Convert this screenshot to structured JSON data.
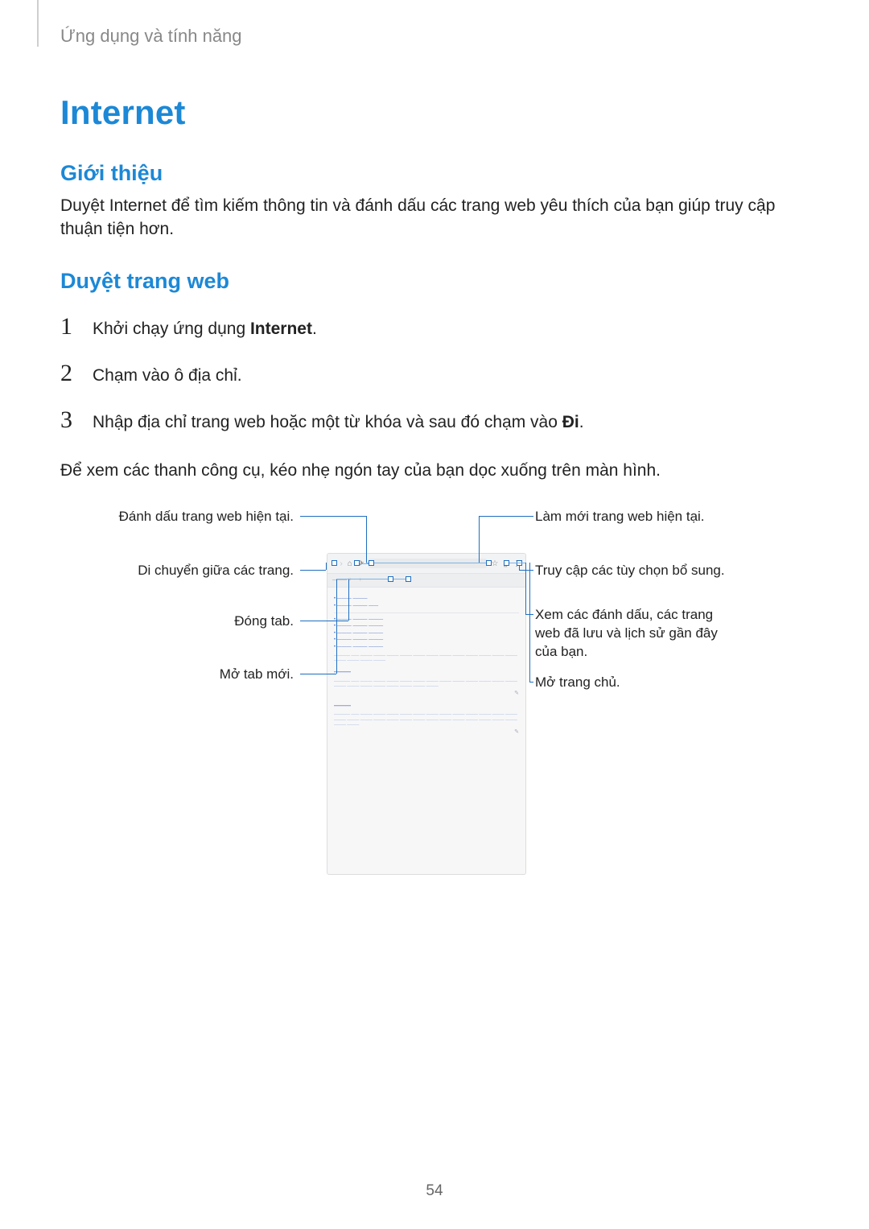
{
  "breadcrumb": "Ứng dụng và tính năng",
  "title": "Internet",
  "section_intro_title": "Giới thiệu",
  "section_intro_text": "Duyệt Internet để tìm kiếm thông tin và đánh dấu các trang web yêu thích của bạn giúp truy cập thuận tiện hơn.",
  "section_browse_title": "Duyệt trang web",
  "steps": {
    "s1_pre": "Khởi chạy ứng dụng ",
    "s1_bold": "Internet",
    "s1_post": ".",
    "s2": "Chạm vào ô địa chỉ.",
    "s3_pre": "Nhập địa chỉ trang web hoặc một từ khóa và sau đó chạm vào ",
    "s3_bold": "Đi",
    "s3_post": "."
  },
  "note": "Để xem các thanh công cụ, kéo nhẹ ngón tay của bạn dọc xuống trên màn hình.",
  "callouts": {
    "bookmark": "Đánh dấu trang web hiện tại.",
    "refresh": "Làm mới trang web hiện tại.",
    "nav": "Di chuyển giữa các trang.",
    "options": "Truy cập các tùy chọn bổ sung.",
    "close_tab": "Đóng tab.",
    "view_bookmarks": "Xem các đánh dấu, các trang web đã lưu và lịch sử gần đây của bạn.",
    "new_tab": "Mở tab mới.",
    "home": "Mở trang chủ."
  },
  "page_number": "54"
}
